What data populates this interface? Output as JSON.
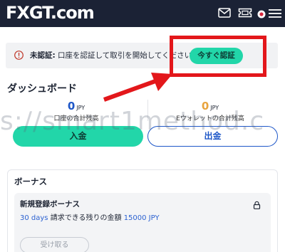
{
  "header": {
    "logo": "FXGT.com"
  },
  "alert": {
    "prefix": "未認証:",
    "message": " 口座を認証して取引を開始してください",
    "button": "今すぐ認証"
  },
  "dashboard": {
    "title": "ダッシュボード",
    "balances": [
      {
        "amount": "0",
        "currency": "JPY",
        "label": "口座の合計残高",
        "color": "#1e57c8"
      },
      {
        "amount": "0",
        "currency": "JPY",
        "label": "Eウォレットの合計残高",
        "color": "#e8a33d"
      }
    ],
    "deposit_label": "入金",
    "withdraw_label": "出金"
  },
  "watermark": "s://smart1method.c",
  "bonus": {
    "section_title": "ボーナス",
    "name": "新規登録ボーナス",
    "days": "30 days",
    "desc_mid": " 請求できる残りの金額 ",
    "amount": "15000 JPY",
    "button": "受け取る"
  },
  "colors": {
    "header_bg": "#1b2235",
    "accent_green": "#22d6a9",
    "accent_blue": "#1e57c8",
    "highlight_red": "#e3171b"
  }
}
